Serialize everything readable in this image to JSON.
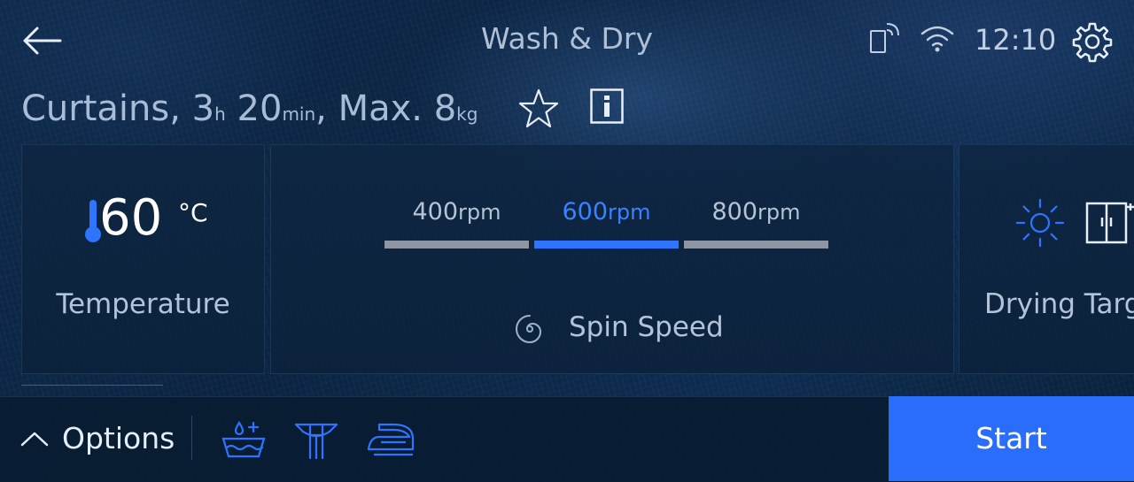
{
  "header": {
    "title": "Wash & Dry",
    "time": "12:10"
  },
  "program": {
    "name": "Curtains,",
    "hours": "3",
    "hours_unit": "h",
    "minutes": "20",
    "minutes_unit": "min",
    "load_prefix": ", Max.",
    "load": "8",
    "load_unit": "kg"
  },
  "temperature": {
    "value": "60",
    "unit": "°C",
    "label": "Temperature"
  },
  "spin": {
    "label": "Spin Speed",
    "options": [
      {
        "value": "400",
        "unit": "rpm"
      },
      {
        "value": "600",
        "unit": "rpm"
      },
      {
        "value": "800",
        "unit": "rpm"
      }
    ],
    "selected": "600"
  },
  "drying": {
    "label": "Drying Targ"
  },
  "bottom": {
    "options_label": "Options",
    "start_label": "Start"
  },
  "icons": [
    "back-arrow-icon",
    "remote-control-icon",
    "wifi-icon",
    "gear-icon",
    "star-icon",
    "info-icon",
    "thermometer-icon",
    "spin-icon",
    "sun-icon",
    "wardrobe-icon",
    "chevron-up-icon",
    "water-plus-icon",
    "hanging-shirt-icon",
    "iron-icon"
  ],
  "colors": {
    "accent": "#2a6dfb",
    "active_text": "#3a82ff",
    "background": "#0d2a4a"
  }
}
